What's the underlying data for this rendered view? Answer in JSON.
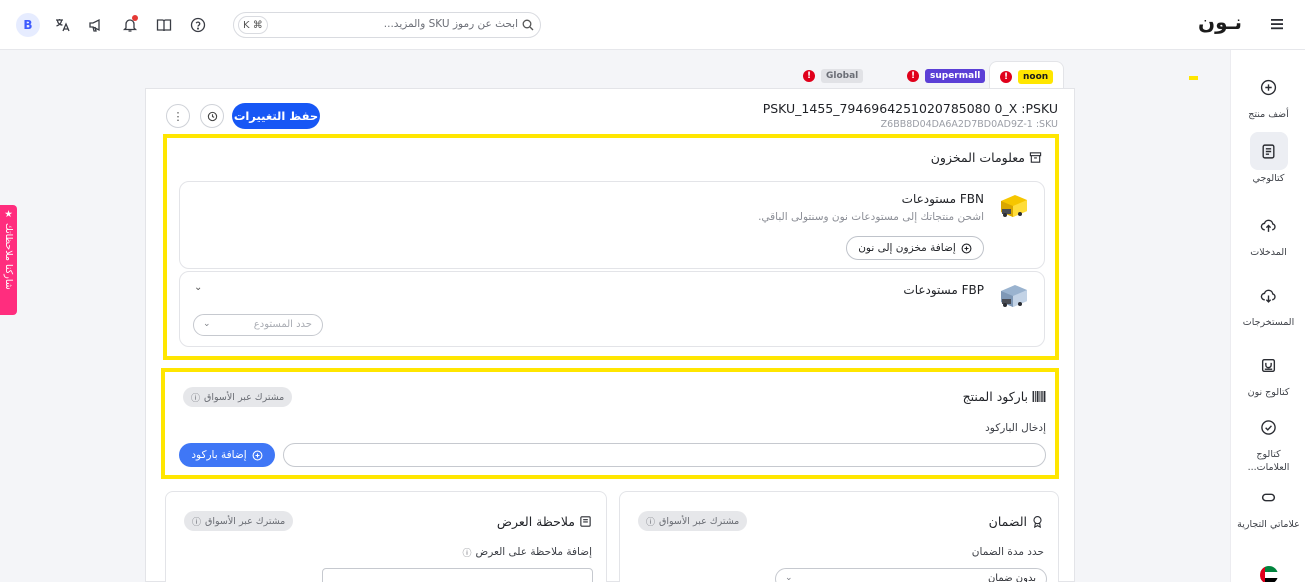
{
  "header": {
    "user_initial": "B",
    "search_placeholder": "ابحث عن رموز SKU والمزيد...",
    "search_shortcut": "K ⌘",
    "logo": "نـون",
    "icons": [
      "translate-icon",
      "megaphone-icon",
      "bell-icon",
      "book-icon",
      "help-icon"
    ]
  },
  "feedback": {
    "label": "★ شاركنا ملاحظاتك"
  },
  "sidebar": {
    "items": [
      {
        "label": "أضف منتج",
        "icon": "add-circle-icon"
      },
      {
        "label": "كتالوجي",
        "icon": "catalog-icon"
      },
      {
        "label": "المدخلات",
        "icon": "cloud-upload-icon"
      },
      {
        "label": "المستخرجات",
        "icon": "cloud-download-icon"
      },
      {
        "label": "كتالوج نون",
        "icon": "noon-catalog-icon"
      },
      {
        "label": "كتالوج العلامات...",
        "icon": "check-circle-icon"
      },
      {
        "label": "علاماتي التجارية",
        "icon": "tag-icon"
      }
    ]
  },
  "marketplaces": [
    {
      "label": "noon",
      "color": "#ffe600",
      "text_color": "#1c1c1c",
      "active": true
    },
    {
      "label": "supermall",
      "color": "#5b3fd6",
      "text_color": "#ffffff",
      "active": false
    },
    {
      "label": "Global",
      "color": "#e1e2e6",
      "text_color": "#6b6e76",
      "active": false
    }
  ],
  "product": {
    "psku": "PSKU_1455_7946964251020785080 0_X :PSKU",
    "sku": "Z6BB8D04DA6A2D7BD0AD9Z-1 :SKU",
    "save_label": "حفظ التغييرات"
  },
  "inventory": {
    "title": "معلومات المخزون",
    "fbn": {
      "title": "مستودعات FBN",
      "desc": "اشحن منتجاتك إلى مستودعات نون وسنتولى الباقي.",
      "button": "إضافة مخزون إلى نون"
    },
    "fbp": {
      "title": "مستودعات FBP",
      "select_placeholder": "حدد المستودع"
    }
  },
  "barcode": {
    "title": "باركود المنتج",
    "shared_chip": "مشترك عبر الأسواق",
    "input_label": "إدخال الباركود",
    "add_button": "إضافة باركود"
  },
  "warranty": {
    "title": "الضمان",
    "shared_chip": "مشترك عبر الأسواق",
    "duration_label": "حدد مدة الضمان",
    "selected": "بدون ضمان"
  },
  "offer_note": {
    "title": "ملاحظة العرض",
    "shared_chip": "مشترك عبر الأسواق",
    "label": "إضافة ملاحظة على العرض"
  }
}
